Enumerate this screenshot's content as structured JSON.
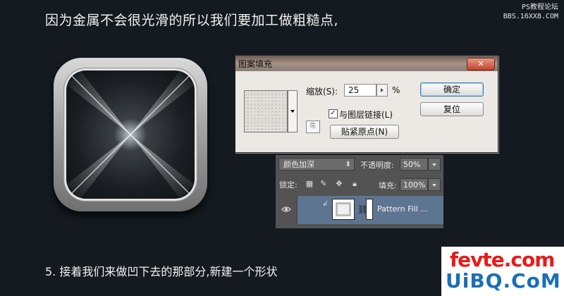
{
  "heading": "因为金属不会很光滑的所以我们要加工做粗糙点,",
  "watermark_top": {
    "line1": "PS教程论坛",
    "line2": "BBS.16XX8.COM"
  },
  "step_text": "5. 接着我们来做凹下去的那部分,新建一个形状",
  "dialog": {
    "title": "图案填充",
    "scale_label": "缩放(S):",
    "scale_value": "25",
    "scale_unit": "%",
    "link_checkbox_label": "与图层链接(L)",
    "link_checked": true,
    "snap_origin_label": "贴紧原点(N)",
    "ok_label": "确定",
    "reset_label": "复位"
  },
  "layers_panel": {
    "blend_mode": "颜色加深",
    "opacity_label": "不透明度:",
    "opacity_value": "50%",
    "lock_label": "锁定:",
    "fill_label": "填充:",
    "fill_value": "100%",
    "layer_name": "Pattern Fill ..."
  },
  "watermark_bottom": {
    "line1": "fevte.com",
    "line2": "UiBQ.CoM"
  },
  "colors": {
    "background": "#141a1f",
    "selected_layer": "#5e7591",
    "wm_red": "#e81a1a",
    "wm_blue": "#1a6fb5"
  }
}
